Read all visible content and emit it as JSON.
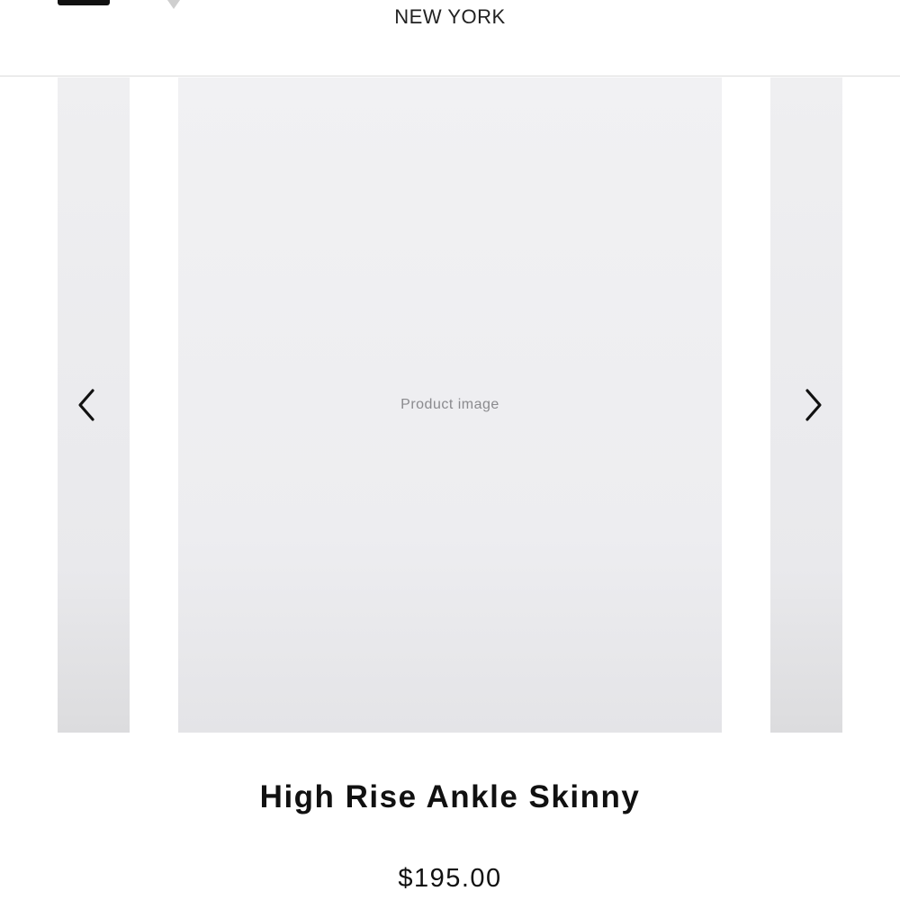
{
  "header": {
    "brand_subtitle": "NEW YORK",
    "menu_icon": "menu-icon",
    "logo_icon": "brand-logo"
  },
  "carousel": {
    "prev_icon": "chevron-left-icon",
    "next_icon": "chevron-right-icon",
    "main_image_placeholder": "Product image"
  },
  "product": {
    "name": "High Rise Ankle Skinny",
    "price": "$195.00"
  },
  "colors": {
    "text": "#111111",
    "divider": "#dcdcdc",
    "image_bg": "#ededf0"
  }
}
